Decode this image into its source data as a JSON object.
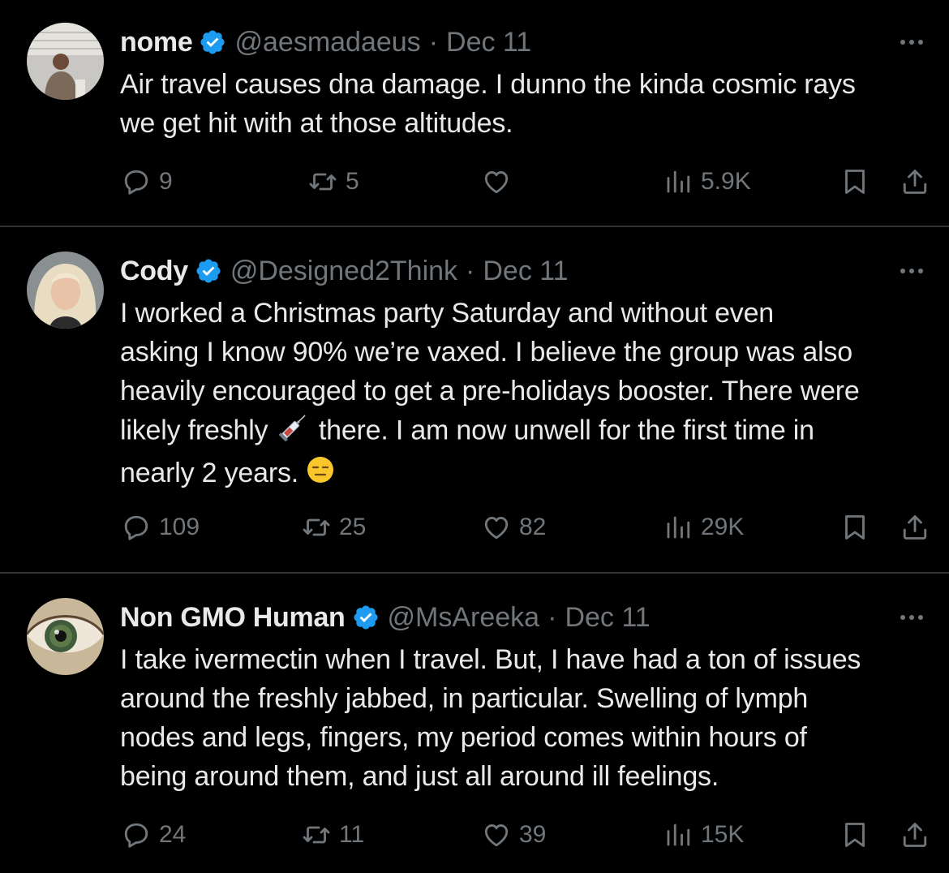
{
  "tweets": [
    {
      "name": "nome",
      "handle": "@aesmadaeus",
      "date": "Dec 11",
      "lines": [
        "Air travel causes dna damage. I dunno the kinda cosmic rays",
        "we get hit with at those altitudes."
      ],
      "replies": "9",
      "retweets": "5",
      "likes": "",
      "views": "5.9K"
    },
    {
      "name": "Cody",
      "handle": "@Designed2Think",
      "date": "Dec 11",
      "lines": [
        "I worked a Christmas party Saturday and without even",
        "asking I know 90% we’re vaxed. I believe the group was also",
        "heavily encouraged to get a pre-holidays booster. There were",
        "likely freshly",
        "there. I am now unwell for the first time in",
        "nearly 2 years."
      ],
      "replies": "109",
      "retweets": "25",
      "likes": "82",
      "views": "29K"
    },
    {
      "name": "Non GMO Human",
      "handle": "@MsAreeka",
      "date": "Dec 11",
      "lines": [
        "I take ivermectin when I travel. But, I have had a ton of issues",
        "around the freshly jabbed, in particular. Swelling of lymph",
        "nodes and legs, fingers, my period comes within hours of",
        "being around them, and just all around ill feelings."
      ],
      "replies": "24",
      "retweets": "11",
      "likes": "39",
      "views": "15K"
    }
  ],
  "separator": "·",
  "icons": {
    "verified": "verified-badge-icon",
    "reply": "reply-icon",
    "retweet": "retweet-icon",
    "like": "heart-icon",
    "views": "views-icon",
    "bookmark": "bookmark-icon",
    "share": "share-icon",
    "more": "more-icon",
    "syringe": "syringe-emoji",
    "face": "expressionless-face-emoji"
  },
  "colors": {
    "background": "#000000",
    "text": "#e7e9ea",
    "muted": "#71767b",
    "verified": "#1d9bf0",
    "divider": "#2f3336"
  }
}
